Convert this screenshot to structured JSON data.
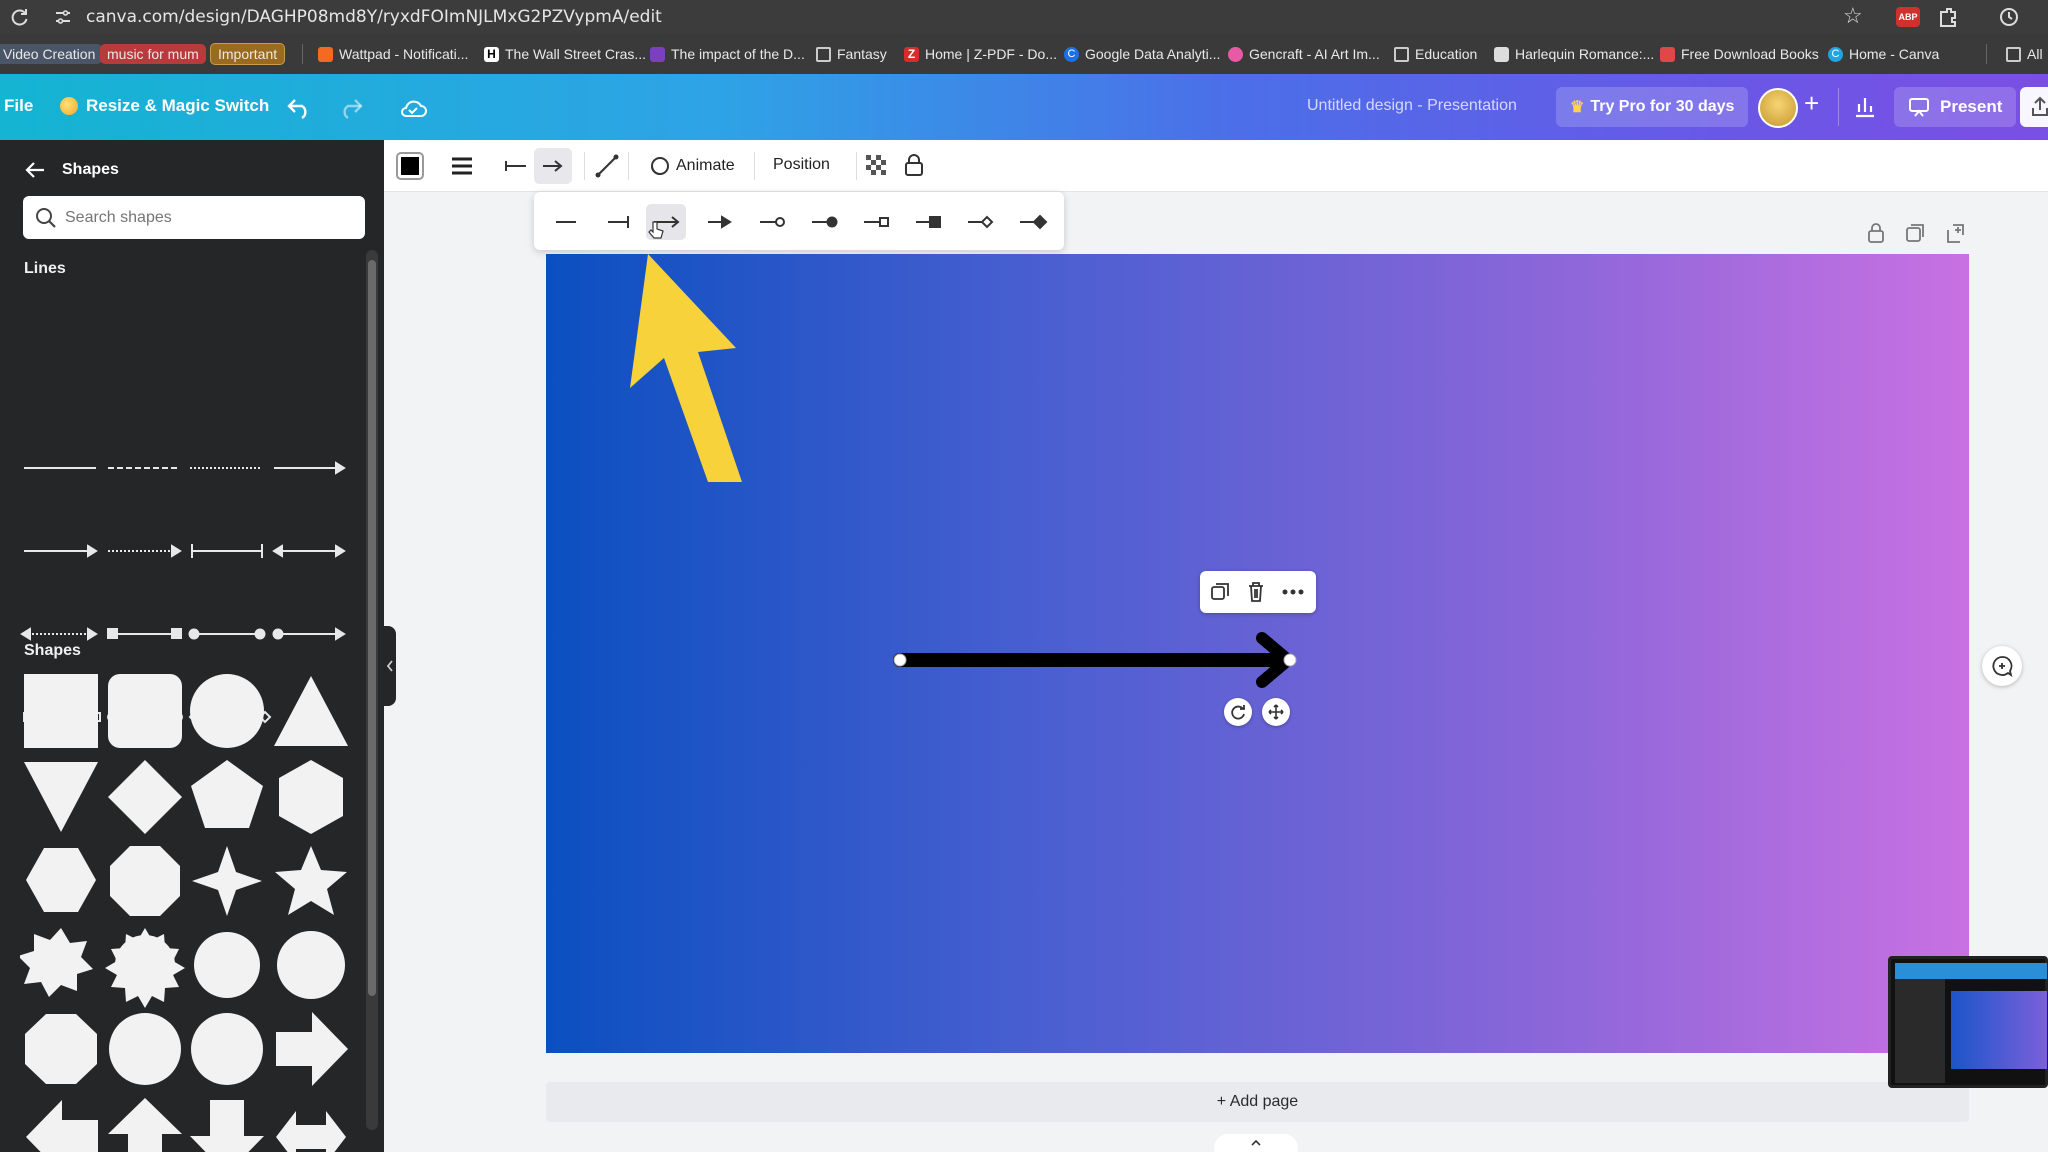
{
  "browser": {
    "url": "canva.com/design/DAGHP08md8Y/ryxdFOImNJLMxG2PZVypmA/edit"
  },
  "bookmarks": [
    {
      "label": "Video Creation",
      "kind": "chip",
      "color": "#4a5568"
    },
    {
      "label": "music for mum",
      "kind": "chip",
      "color": "#b83a3a"
    },
    {
      "label": "Important",
      "kind": "chip",
      "color": "#9a6a1e"
    },
    {
      "label": "Wattpad - Notificati...",
      "icon": "wattpad-icon",
      "color": "#f26b21"
    },
    {
      "label": "The Wall Street Cras...",
      "icon": "h-icon",
      "color": "#ffffff"
    },
    {
      "label": "The impact of the D...",
      "icon": "onenote-icon",
      "color": "#7b3fbf"
    },
    {
      "label": "Fantasy",
      "icon": "folder-icon",
      "color": "#cccccc"
    },
    {
      "label": "Home | Z-PDF - Do...",
      "icon": "zpdf-icon",
      "color": "#d92b2b"
    },
    {
      "label": "Google Data Analyti...",
      "icon": "coursera-icon",
      "color": "#1f6fe8"
    },
    {
      "label": "Gencraft - AI Art Im...",
      "icon": "gencraft-icon",
      "color": "#e85aa5"
    },
    {
      "label": "Education",
      "icon": "folder-icon",
      "color": "#cccccc"
    },
    {
      "label": "Harlequin Romance:...",
      "icon": "harlequin-icon",
      "color": "#dddddd"
    },
    {
      "label": "Free Download Books",
      "icon": "book-icon",
      "color": "#e04848"
    },
    {
      "label": "Home - Canva",
      "icon": "canva-icon",
      "color": "#1fa5e0"
    },
    {
      "label": "All",
      "icon": "folder-icon",
      "color": "#cccccc"
    }
  ],
  "topbar": {
    "file": "File",
    "resize": "Resize & Magic Switch",
    "design_title": "Untitled design - Presentation",
    "try_pro": "Try Pro for 30 days",
    "present": "Present"
  },
  "sidebar": {
    "title": "Shapes",
    "search_placeholder": "Search shapes",
    "lines_heading": "Lines",
    "shapes_heading": "Shapes"
  },
  "toolbar": {
    "animate": "Animate",
    "position": "Position"
  },
  "canvas": {
    "add_page": "+ Add page"
  },
  "colors": {
    "accent_yellow": "#f7d23a",
    "arrow_black": "#000000"
  }
}
